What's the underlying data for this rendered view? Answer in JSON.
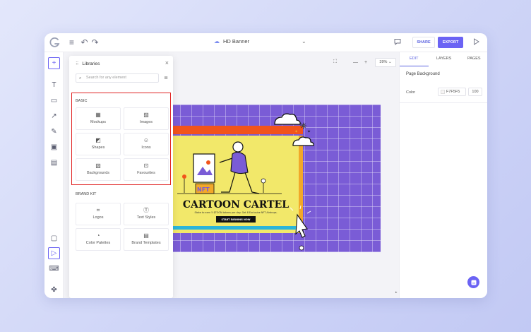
{
  "topbar": {
    "doc_title": "HD Banner",
    "share_label": "SHARE",
    "export_label": "EXPORT",
    "icons": [
      "menu-icon",
      "undo-icon",
      "redo-icon",
      "cloud-icon",
      "chevron-down-icon",
      "comment-icon",
      "play-icon"
    ]
  },
  "canvas": {
    "zoom": "39%",
    "zoom_out": "—",
    "zoom_in": "+"
  },
  "artwork": {
    "headline": "CARTOON CARTEL",
    "subtext": "Stake to earn 5 $TOON tokens per day. Get 8 Exclusive NFT Airdrops.",
    "cta": "START EARNING NOW",
    "badge": "NFT"
  },
  "libraries": {
    "title": "Libraries",
    "search_placeholder": "Search for any element",
    "basic_label": "BASIC",
    "basic_items": [
      {
        "label": "Mockups",
        "icon": "mockup-icon"
      },
      {
        "label": "Images",
        "icon": "image-icon"
      },
      {
        "label": "Shapes",
        "icon": "shapes-icon"
      },
      {
        "label": "Icons",
        "icon": "smiley-icon"
      },
      {
        "label": "Backgrounds",
        "icon": "backgrounds-icon"
      },
      {
        "label": "Favourites",
        "icon": "favourites-icon"
      }
    ],
    "brand_label": "BRAND KIT",
    "brand_items": [
      {
        "label": "Logos",
        "icon": "logo-icon"
      },
      {
        "label": "Text Styles",
        "icon": "text-style-icon"
      },
      {
        "label": "Color Palettes",
        "icon": "palette-icon"
      },
      {
        "label": "Brand Templates",
        "icon": "template-icon"
      }
    ]
  },
  "right_panel": {
    "tabs": [
      "EDIT",
      "LAYERS",
      "PAGES"
    ],
    "active_tab": "EDIT",
    "section_title": "Page Background",
    "color_label": "Color",
    "color_value": "F7F5F5",
    "opacity_value": "100"
  },
  "colors": {
    "accent": "#6B63F4",
    "highlight_frame": "#E02424",
    "art_grid": "#7A5CD6",
    "art_panel": "#F2E86A",
    "art_bar": "#F2541B"
  }
}
